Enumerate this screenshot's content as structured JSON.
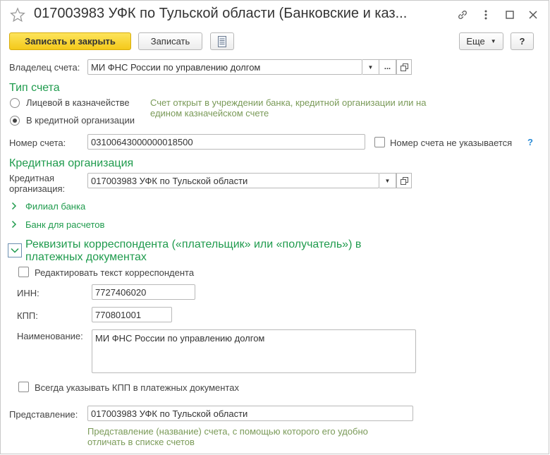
{
  "window": {
    "title": "017003983 УФК по Тульской области (Банковские и каз..."
  },
  "toolbar": {
    "save_close_label": "Записать и закрыть",
    "save_label": "Записать",
    "more_label": "Еще",
    "help_label": "?"
  },
  "owner": {
    "label": "Владелец счета:",
    "value": "МИ ФНС России по управлению долгом",
    "dots_label": "..."
  },
  "account_type": {
    "heading": "Тип счета",
    "options": [
      {
        "label": "Лицевой в казначействе",
        "selected": false
      },
      {
        "label": "В кредитной организации",
        "selected": true
      }
    ],
    "hint": "Счет открыт в учреждении банка, кредитной организации или на едином казначейском счете"
  },
  "account_number": {
    "label": "Номер счета:",
    "value": "03100643000000018500",
    "not_specified_label": "Номер счета не указывается",
    "help": "?"
  },
  "credit_org": {
    "heading": "Кредитная организация",
    "label_line1": "Кредитная",
    "label_line2": "организация:",
    "value": "017003983 УФК по Тульской области",
    "branch_label": "Филиал банка",
    "settlement_bank_label": "Банк для расчетов"
  },
  "correspondent": {
    "heading_line1": "Реквизиты корреспондента («плательщик» или «получатель») в",
    "heading_line2": "платежных документах",
    "edit_text_label": "Редактировать текст корреспондента",
    "inn_label": "ИНН:",
    "inn_value": "7727406020",
    "kpp_label": "КПП:",
    "kpp_value": "770801001",
    "name_label": "Наименование:",
    "name_value": "МИ ФНС России по управлению долгом",
    "always_kpp_label": "Всегда указывать КПП в платежных документах"
  },
  "representation": {
    "label": "Представление:",
    "value": "017003983 УФК по Тульской области",
    "hint_line1": "Представление (название) счета, с помощью которого его удобно",
    "hint_line2": "отличать в списке счетов"
  },
  "colors": {
    "accent_green": "#1f9b4d",
    "primary_button": "#f4c91a"
  },
  "icons": {
    "favorite": "star-icon",
    "link": "link-icon",
    "menu": "more-vertical-icon",
    "maximize": "maximize-icon",
    "close": "close-icon",
    "report": "report-icon"
  }
}
